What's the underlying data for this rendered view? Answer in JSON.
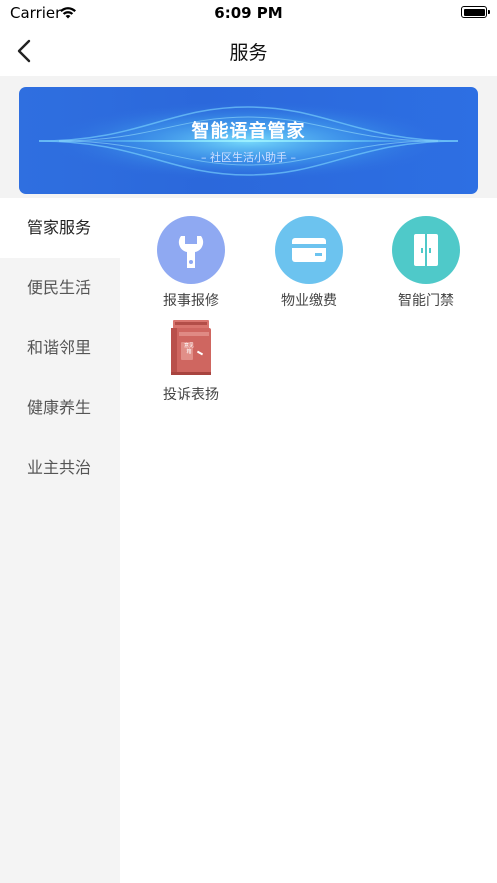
{
  "status_bar": {
    "carrier": "Carrier",
    "time": "6:09 PM"
  },
  "navbar": {
    "title": "服务"
  },
  "banner": {
    "title": "智能语音管家",
    "subtitle": "– 社区生活小助手 –"
  },
  "sidebar": {
    "items": [
      {
        "label": "管家服务",
        "active": true
      },
      {
        "label": "便民生活",
        "active": false
      },
      {
        "label": "和谐邻里",
        "active": false
      },
      {
        "label": "健康养生",
        "active": false
      },
      {
        "label": "业主共治",
        "active": false
      }
    ]
  },
  "services": [
    {
      "label": "报事报修",
      "icon": "wrench-icon",
      "color": "#8fa9f2"
    },
    {
      "label": "物业缴费",
      "icon": "card-icon",
      "color": "#6cc3ef"
    },
    {
      "label": "智能门禁",
      "icon": "door-icon",
      "color": "#4fc9c9"
    },
    {
      "label": "投诉表扬",
      "icon": "mailbox-icon",
      "color": "#c9605a",
      "icon_text": "意见箱"
    }
  ]
}
